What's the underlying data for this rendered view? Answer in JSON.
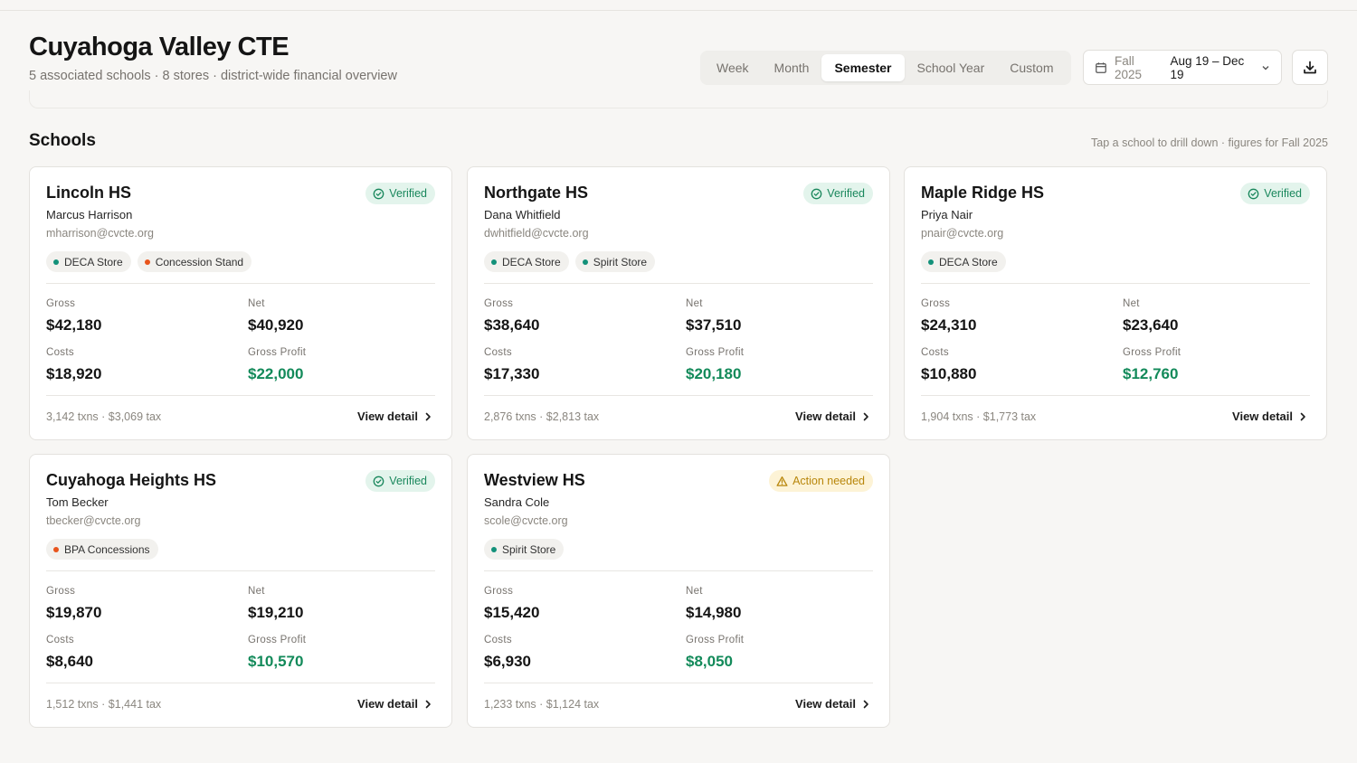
{
  "header": {
    "title": "Cuyahoga Valley CTE",
    "subtitle": "5 associated schools · 8 stores · district-wide financial overview"
  },
  "period_tabs": [
    {
      "label": "Week",
      "active": false
    },
    {
      "label": "Month",
      "active": false
    },
    {
      "label": "Semester",
      "active": true
    },
    {
      "label": "School Year",
      "active": false
    },
    {
      "label": "Custom",
      "active": false
    }
  ],
  "date_range": {
    "term": "Fall 2025",
    "dates": "Aug 19 – Dec 19",
    "icon": "calendar-icon"
  },
  "download": {
    "icon": "download-icon"
  },
  "section": {
    "title": "Schools",
    "hint": "Tap a school to drill down · figures for Fall 2025"
  },
  "labels": {
    "gross": "Gross",
    "net": "Net",
    "costs": "Costs",
    "gross_profit": "Gross Profit",
    "view_detail": "View detail"
  },
  "colors": {
    "accent_green": "#138a5a",
    "tag_teal": "#13917a",
    "tag_orange": "#e8541c",
    "verified_bg": "#e3f4ec",
    "action_bg": "#fdf3d6"
  },
  "schools": [
    {
      "name": "Lincoln HS",
      "status": "Verified",
      "status_type": "verified",
      "contact": "Marcus Harrison",
      "email": "mharrison@cvcte.org",
      "stores": [
        {
          "label": "DECA Store",
          "color": "#13917a"
        },
        {
          "label": "Concession Stand",
          "color": "#e8541c"
        }
      ],
      "gross": "$42,180",
      "net": "$40,920",
      "costs": "$18,920",
      "gross_profit": "$22,000",
      "footer": "3,142 txns · $3,069 tax"
    },
    {
      "name": "Northgate HS",
      "status": "Verified",
      "status_type": "verified",
      "contact": "Dana Whitfield",
      "email": "dwhitfield@cvcte.org",
      "stores": [
        {
          "label": "DECA Store",
          "color": "#13917a"
        },
        {
          "label": "Spirit Store",
          "color": "#13917a"
        }
      ],
      "gross": "$38,640",
      "net": "$37,510",
      "costs": "$17,330",
      "gross_profit": "$20,180",
      "footer": "2,876 txns · $2,813 tax"
    },
    {
      "name": "Maple Ridge HS",
      "status": "Verified",
      "status_type": "verified",
      "contact": "Priya Nair",
      "email": "pnair@cvcte.org",
      "stores": [
        {
          "label": "DECA Store",
          "color": "#13917a"
        }
      ],
      "gross": "$24,310",
      "net": "$23,640",
      "costs": "$10,880",
      "gross_profit": "$12,760",
      "footer": "1,904 txns · $1,773 tax"
    },
    {
      "name": "Cuyahoga Heights HS",
      "status": "Verified",
      "status_type": "verified",
      "contact": "Tom Becker",
      "email": "tbecker@cvcte.org",
      "stores": [
        {
          "label": "BPA Concessions",
          "color": "#e8541c"
        }
      ],
      "gross": "$19,870",
      "net": "$19,210",
      "costs": "$8,640",
      "gross_profit": "$10,570",
      "footer": "1,512 txns · $1,441 tax"
    },
    {
      "name": "Westview HS",
      "status": "Action needed",
      "status_type": "action",
      "contact": "Sandra Cole",
      "email": "scole@cvcte.org",
      "stores": [
        {
          "label": "Spirit Store",
          "color": "#13917a"
        }
      ],
      "gross": "$15,420",
      "net": "$14,980",
      "costs": "$6,930",
      "gross_profit": "$8,050",
      "footer": "1,233 txns · $1,124 tax"
    }
  ]
}
